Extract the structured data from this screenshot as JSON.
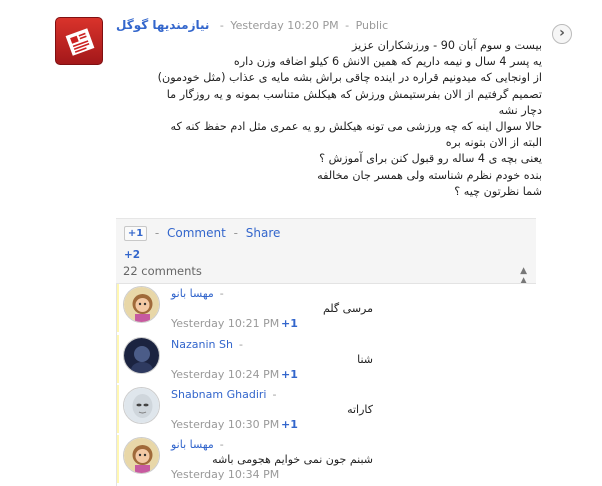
{
  "post": {
    "author": "نیازمندیها گوگل",
    "timestamp": "Yesterday 10:20 PM",
    "visibility": "Public",
    "lines": [
      "بیست و سوم آبان 90 - ورزشکاران عزیز",
      "یه پسر 4 سال و نیمه داریم که همین الانش 6 کیلو اضافه وزن داره",
      "از اونجایی که میدونیم قراره در اینده چاقی براش بشه مایه ی عذاب (مثل خودمون)",
      "تصمیم گرفتیم از الان بفرستیمش ورزش که هیکلش متناسب بمونه و یه روزگار ما",
      "دچار نشه",
      "حالا سوال اینه که چه ورزشی می تونه هیکلش رو یه عمری مثل ادم حفظ کنه که",
      "البته از الان بتونه بره",
      "یعنی بچه ی 4 ساله رو قبول کنن برای آموزش ؟",
      "بنده خودم نظرم شناسته ولی همسر جان مخالفه",
      "شما نظرتون چیه ؟"
    ]
  },
  "actions": {
    "plus_label": "+1",
    "comment_label": "Comment",
    "share_label": "Share",
    "plus_count": "+2",
    "comments_count": "22 comments"
  },
  "comments": [
    {
      "name": "مهسا بانو",
      "text": "مرسی گلم",
      "time": "Yesterday 10:21 PM",
      "plus": "+1"
    },
    {
      "name": "Nazanin Sh",
      "text": "شنا",
      "time": "Yesterday 10:24 PM",
      "plus": "+1"
    },
    {
      "name": "Shabnam Ghadiri",
      "text": "کاراته",
      "time": "Yesterday 10:30 PM",
      "plus": "+1"
    },
    {
      "name": "مهسا بانو",
      "text": "شبنم جون نمی خوایم هجومی باشه",
      "time": "Yesterday 10:34 PM",
      "plus": ""
    }
  ]
}
